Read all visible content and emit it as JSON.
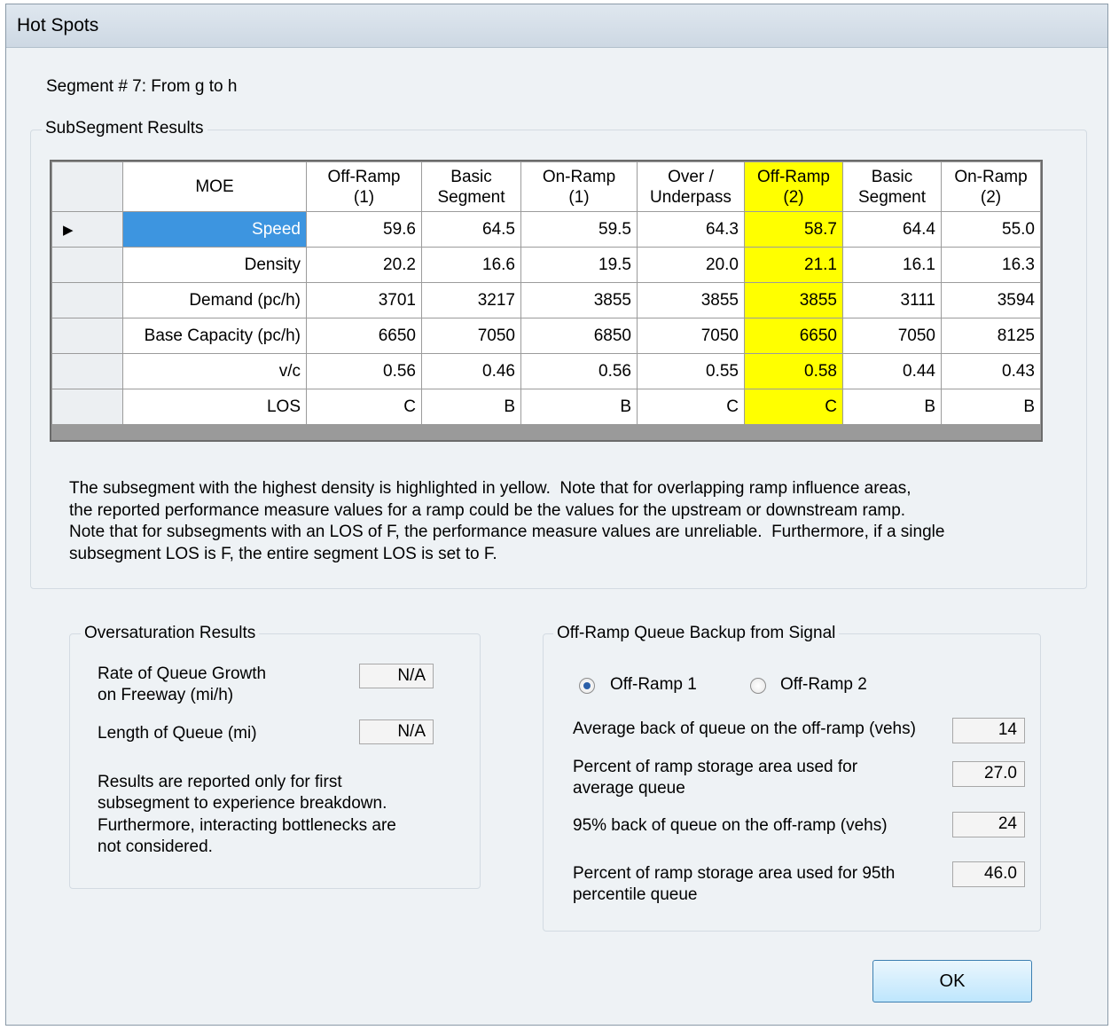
{
  "window": {
    "title": "Hot Spots"
  },
  "segment_label": "Segment # 7:  From g to h",
  "subsegment": {
    "group_label": "SubSegment Results",
    "current_row_marker": "▶",
    "columns": [
      "MOE",
      "Off-Ramp\n(1)",
      "Basic\nSegment",
      "On-Ramp\n(1)",
      "Over /\nUnderpass",
      "Off-Ramp\n(2)",
      "Basic\nSegment",
      "On-Ramp\n(2)"
    ],
    "highlight_color": "#ffff00",
    "selected_color": "#3d95e0",
    "rows": [
      {
        "label": "Speed",
        "values": [
          "59.6",
          "64.5",
          "59.5",
          "64.3",
          "58.7",
          "64.4",
          "55.0"
        ]
      },
      {
        "label": "Density",
        "values": [
          "20.2",
          "16.6",
          "19.5",
          "20.0",
          "21.1",
          "16.1",
          "16.3"
        ]
      },
      {
        "label": "Demand (pc/h)",
        "values": [
          "3701",
          "3217",
          "3855",
          "3855",
          "3855",
          "3111",
          "3594"
        ]
      },
      {
        "label": "Base Capacity (pc/h)",
        "values": [
          "6650",
          "7050",
          "6850",
          "7050",
          "6650",
          "7050",
          "8125"
        ]
      },
      {
        "label": "v/c",
        "values": [
          "0.56",
          "0.46",
          "0.56",
          "0.55",
          "0.58",
          "0.44",
          "0.43"
        ]
      },
      {
        "label": "LOS",
        "values": [
          "C",
          "B",
          "B",
          "C",
          "C",
          "B",
          "B"
        ]
      }
    ],
    "note": "The subsegment with the highest density is highlighted in yellow.  Note that for overlapping ramp influence areas,\nthe reported performance measure values for a ramp could be the values for the upstream or downstream ramp.\nNote that for subsegments with an LOS of F, the performance measure values are unreliable.  Furthermore, if a single\nsubsegment LOS is F, the entire segment LOS is set to F."
  },
  "oversaturation": {
    "group_label": "Oversaturation Results",
    "queue_growth_label_1": "Rate of Queue Growth",
    "queue_growth_label_2": "on Freeway (mi/h)",
    "queue_growth_value": "N/A",
    "queue_length_label": "Length of Queue (mi)",
    "queue_length_value": "N/A",
    "note_lines": [
      "Results are reported only for first",
      "subsegment to experience breakdown.",
      "Furthermore, interacting bottlenecks are",
      "not considered."
    ]
  },
  "offramp": {
    "group_label": "Off-Ramp Queue Backup from Signal",
    "radio_1": "Off-Ramp 1",
    "radio_2": "Off-Ramp 2",
    "selected_radio": 1,
    "avg_back_label": "Average back of queue on the off-ramp (vehs)",
    "avg_back_value": "14",
    "pct_avg_label_1": "Percent of ramp storage area used for",
    "pct_avg_label_2": "average queue",
    "pct_avg_value": "27.0",
    "p95_back_label": "95% back of queue on the off-ramp (vehs)",
    "p95_back_value": "24",
    "pct_95_label_1": "Percent of ramp storage area used for 95th",
    "pct_95_label_2": "percentile queue",
    "pct_95_value": "46.0"
  },
  "buttons": {
    "ok": "OK"
  }
}
